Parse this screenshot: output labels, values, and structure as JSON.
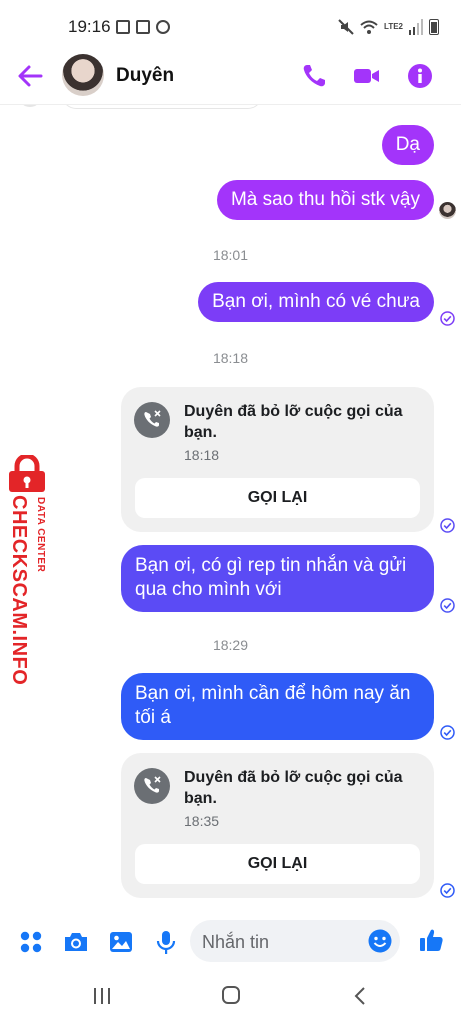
{
  "status_bar": {
    "time": "19:16",
    "network_label": "LTE2"
  },
  "header": {
    "contact_name": "Duyên",
    "accent": "#a334fa"
  },
  "messages": [
    {
      "id": "m1",
      "text": "Dạ",
      "color": "#a334fa"
    },
    {
      "id": "m2",
      "text": "Mà sao thu hồi stk vậy",
      "color": "#a334fa"
    },
    {
      "id": "t1",
      "timestamp": "18:01"
    },
    {
      "id": "m3",
      "text": "Bạn ơi, mình có vé chưa",
      "color": "#7c3df7"
    },
    {
      "id": "t2",
      "timestamp": "18:18"
    },
    {
      "id": "c1",
      "call_text": "Duyên đã bỏ lỡ cuộc gọi của bạn.",
      "call_time": "18:18",
      "button": "GỌI LẠI"
    },
    {
      "id": "m4",
      "text": "Bạn ơi, có gì rep tin nhắn và gửi qua cho mình với",
      "color": "#5b4bf5"
    },
    {
      "id": "t3",
      "timestamp": "18:29"
    },
    {
      "id": "m5",
      "text": "Bạn ơi, mình cần để hôm nay ăn tối á",
      "color": "#2f5bf7"
    },
    {
      "id": "c2",
      "call_text": "Duyên đã bỏ lỡ cuộc gọi của bạn.",
      "call_time": "18:35",
      "button": "GỌI LẠI"
    }
  ],
  "watermark": {
    "main": "CHECKSCAM.INFO",
    "sub": "DATA CENTER"
  },
  "composer": {
    "placeholder": "Nhắn tin"
  }
}
